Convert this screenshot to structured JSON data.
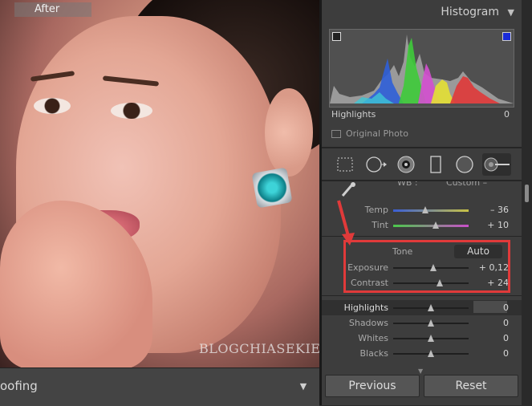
{
  "photo": {
    "view_label": "After",
    "watermark": "BLOGCHIASEKIENTHUC.COM"
  },
  "bottom_bar": {
    "label": "oofing"
  },
  "histogram": {
    "title": "Histogram",
    "readout_label": "Highlights",
    "readout_value": "0",
    "original_photo_label": "Original Photo"
  },
  "tools": [
    "crop-overlay",
    "spot-removal",
    "red-eye-correction",
    "graduated-filter",
    "radial-filter",
    "adjustment-brush"
  ],
  "basic": {
    "wb_label": "WB :",
    "wb_value": "Custom –",
    "rows": [
      {
        "label": "Temp",
        "value": "– 36",
        "position": 0.43
      },
      {
        "label": "Tint",
        "value": "+ 10",
        "position": 0.56
      },
      {
        "label": "Exposure",
        "value": "+ 0,12",
        "position": 0.53
      },
      {
        "label": "Contrast",
        "value": "+ 24",
        "position": 0.62
      },
      {
        "label": "Highlights",
        "value": "0",
        "position": 0.5
      },
      {
        "label": "Shadows",
        "value": "0",
        "position": 0.5
      },
      {
        "label": "Whites",
        "value": "0",
        "position": 0.5
      },
      {
        "label": "Blacks",
        "value": "0",
        "position": 0.5
      }
    ],
    "tone_label": "Tone",
    "auto_label": "Auto"
  },
  "buttons": {
    "previous": "Previous",
    "reset": "Reset"
  },
  "colors": {
    "highlight_annotation": "#e03a3a",
    "panel_bg": "#3d3d3d"
  }
}
